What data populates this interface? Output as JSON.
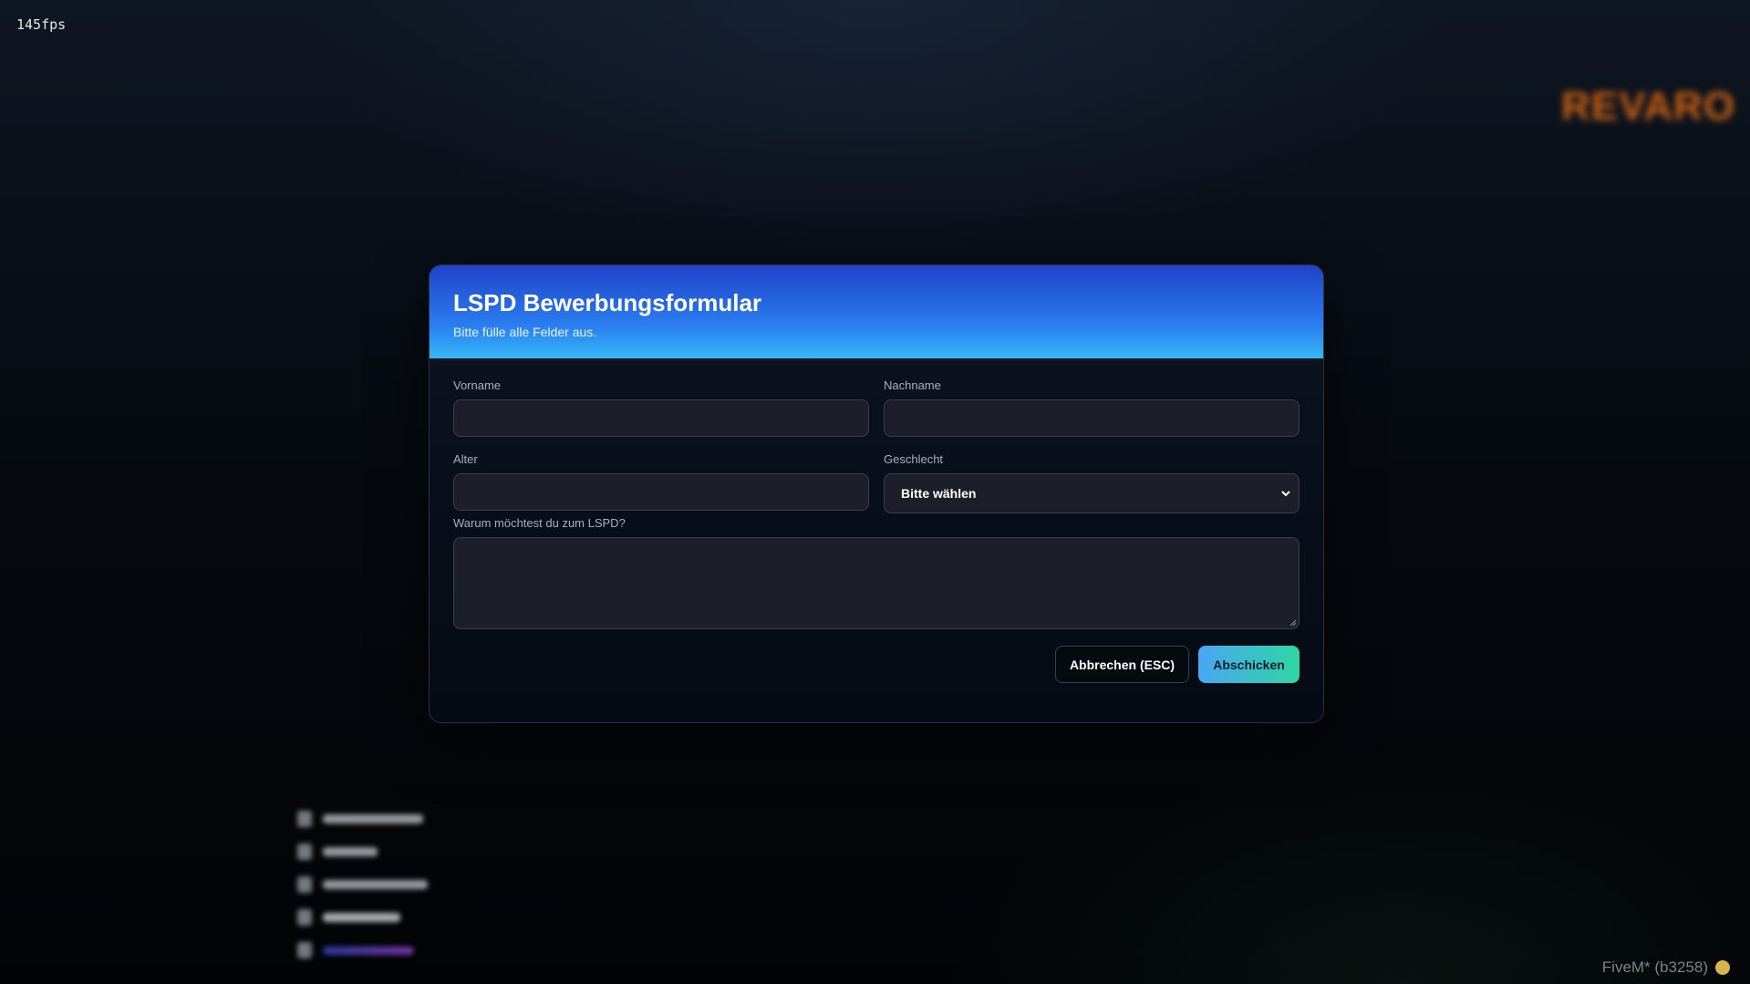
{
  "overlay": {
    "fps": "145fps",
    "server_logo": "REVARO",
    "watermark": "FiveM* (b3258)"
  },
  "modal": {
    "title": "LSPD Bewerbungsformular",
    "subtitle": "Bitte fülle alle Felder aus.",
    "fields": {
      "vorname": {
        "label": "Vorname",
        "value": ""
      },
      "nachname": {
        "label": "Nachname",
        "value": ""
      },
      "alter": {
        "label": "Alter",
        "value": ""
      },
      "geschlecht": {
        "label": "Geschlecht",
        "selected": "Bitte wählen"
      },
      "motivation": {
        "label": "Warum möchtest du zum LSPD?",
        "value": ""
      }
    },
    "buttons": {
      "cancel": "Abbrechen (ESC)",
      "submit": "Abschicken"
    }
  },
  "colors": {
    "header_gradient_start": "#1f42c8",
    "header_gradient_end": "#35b8f5",
    "submit_gradient_start": "#4aa6f2",
    "submit_gradient_end": "#2fd6a4",
    "logo_orange": "#e26a10"
  }
}
